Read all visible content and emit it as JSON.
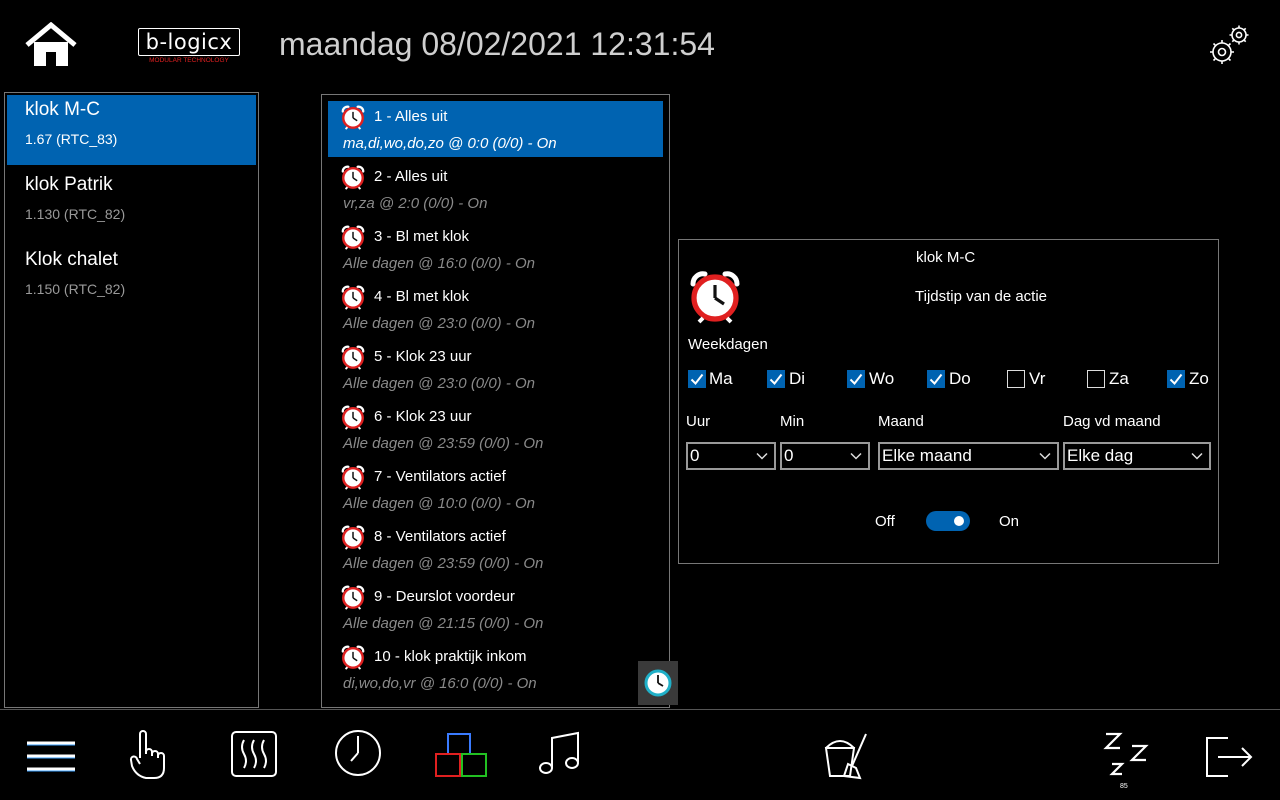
{
  "header": {
    "logo_text": "b-logicx",
    "logo_subtitle": "MODULAR TECHNOLOGY",
    "datetime": "maandag 08/02/2021 12:31:54"
  },
  "devices": [
    {
      "name": "klok M-C",
      "sub": "1.67 (RTC_83)",
      "selected": true
    },
    {
      "name": "klok Patrik",
      "sub": "1.130 (RTC_82)",
      "selected": false
    },
    {
      "name": "Klok chalet",
      "sub": "1.150 (RTC_82)",
      "selected": false
    }
  ],
  "schedules": [
    {
      "title": "1 - Alles uit",
      "desc": "ma,di,wo,do,zo @ 0:0 (0/0) - On",
      "selected": true
    },
    {
      "title": "2 - Alles uit",
      "desc": "vr,za @ 2:0 (0/0) - On"
    },
    {
      "title": "3 - Bl met klok",
      "desc": "Alle dagen @ 16:0 (0/0) - On"
    },
    {
      "title": "4 - Bl met klok",
      "desc": "Alle dagen @ 23:0 (0/0) - On"
    },
    {
      "title": "5 - Klok 23 uur",
      "desc": "Alle dagen @ 23:0 (0/0) - On"
    },
    {
      "title": "6 - Klok 23 uur",
      "desc": "Alle dagen @ 23:59 (0/0) - On"
    },
    {
      "title": "7 - Ventilators actief",
      "desc": "Alle dagen @ 10:0 (0/0) - On"
    },
    {
      "title": "8 - Ventilators actief",
      "desc": "Alle dagen @ 23:59 (0/0) - On"
    },
    {
      "title": "9 - Deurslot voordeur",
      "desc": "Alle dagen @ 21:15 (0/0) - On"
    },
    {
      "title": "10 - klok praktijk inkom",
      "desc": "di,wo,do,vr @ 16:0 (0/0) - On"
    }
  ],
  "detail": {
    "device_name": "klok M-C",
    "subtitle": "Tijdstip van de actie",
    "weekdays_label": "Weekdagen",
    "days": [
      {
        "label": "Ma",
        "checked": true
      },
      {
        "label": "Di",
        "checked": true
      },
      {
        "label": "Wo",
        "checked": true
      },
      {
        "label": "Do",
        "checked": true
      },
      {
        "label": "Vr",
        "checked": false
      },
      {
        "label": "Za",
        "checked": false
      },
      {
        "label": "Zo",
        "checked": true
      }
    ],
    "hour_label": "Uur",
    "min_label": "Min",
    "month_label": "Maand",
    "daymonth_label": "Dag vd maand",
    "hour_value": "0",
    "min_value": "0",
    "month_value": "Elke maand",
    "daymonth_value": "Elke dag",
    "off_label": "Off",
    "on_label": "On",
    "toggle_on": true
  },
  "footer": {
    "sleep_badge": "85"
  },
  "colors": {
    "accent": "#0063b1",
    "alarm_red": "#e02020"
  }
}
